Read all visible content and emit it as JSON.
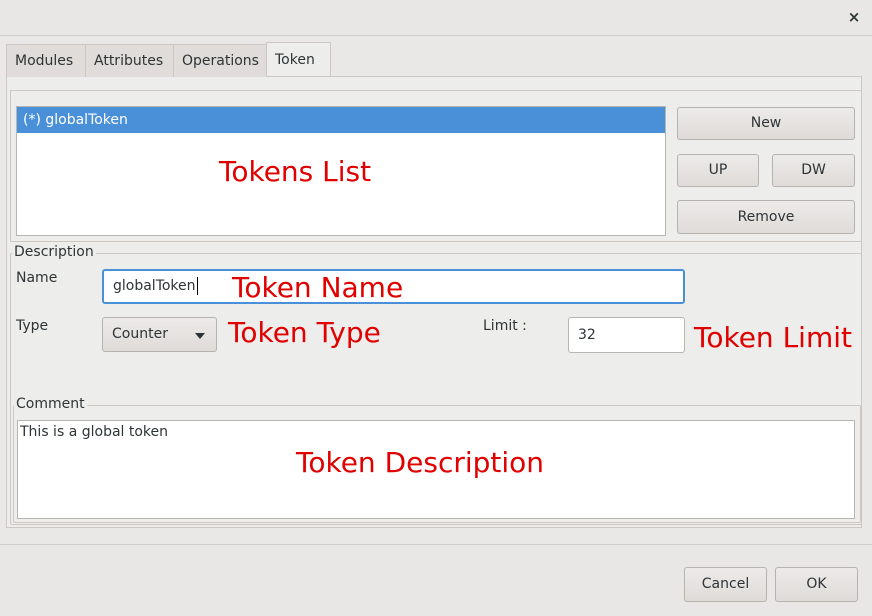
{
  "window": {
    "close_glyph": "×"
  },
  "tabs": [
    {
      "label": "Modules",
      "active": false
    },
    {
      "label": "Attributes",
      "active": false
    },
    {
      "label": "Operations",
      "active": false
    },
    {
      "label": "Token",
      "active": true
    }
  ],
  "tokens": {
    "items": [
      "(*) globalToken"
    ],
    "selected_index": 0,
    "annotation": "Tokens List"
  },
  "list_buttons": {
    "new": "New",
    "up": "UP",
    "down": "DW",
    "remove": "Remove"
  },
  "description": {
    "legend": "Description",
    "name_label": "Name",
    "name_value": "globalToken",
    "name_annotation": "Token Name",
    "type_label": "Type",
    "type_value": "Counter",
    "type_annotation": "Token Type",
    "limit_label": "Limit :",
    "limit_value": "32",
    "limit_annotation": "Token Limit"
  },
  "comment": {
    "legend": "Comment",
    "value": "This is a global token",
    "annotation": "Token Description"
  },
  "dialog_buttons": {
    "cancel": "Cancel",
    "ok": "OK"
  },
  "colors": {
    "selection": "#4a90d9",
    "annotation": "#e00000",
    "focus": "#4a90d9"
  }
}
